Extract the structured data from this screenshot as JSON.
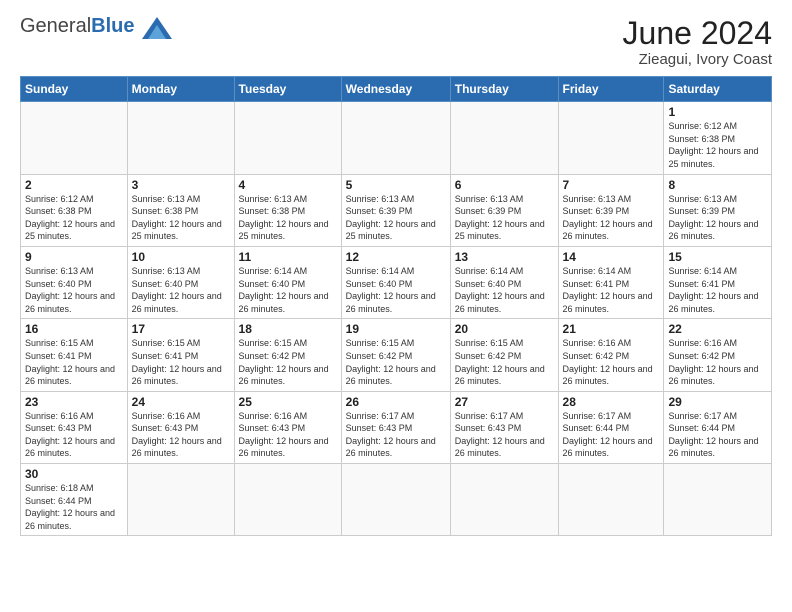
{
  "logo": {
    "text_general": "General",
    "text_blue": "Blue"
  },
  "header": {
    "title": "June 2024",
    "subtitle": "Zieagui, Ivory Coast"
  },
  "weekdays": [
    "Sunday",
    "Monday",
    "Tuesday",
    "Wednesday",
    "Thursday",
    "Friday",
    "Saturday"
  ],
  "weeks": [
    [
      {
        "day": "",
        "info": ""
      },
      {
        "day": "",
        "info": ""
      },
      {
        "day": "",
        "info": ""
      },
      {
        "day": "",
        "info": ""
      },
      {
        "day": "",
        "info": ""
      },
      {
        "day": "",
        "info": ""
      },
      {
        "day": "1",
        "info": "Sunrise: 6:12 AM\nSunset: 6:38 PM\nDaylight: 12 hours and 25 minutes."
      }
    ],
    [
      {
        "day": "2",
        "info": "Sunrise: 6:12 AM\nSunset: 6:38 PM\nDaylight: 12 hours and 25 minutes."
      },
      {
        "day": "3",
        "info": "Sunrise: 6:13 AM\nSunset: 6:38 PM\nDaylight: 12 hours and 25 minutes."
      },
      {
        "day": "4",
        "info": "Sunrise: 6:13 AM\nSunset: 6:38 PM\nDaylight: 12 hours and 25 minutes."
      },
      {
        "day": "5",
        "info": "Sunrise: 6:13 AM\nSunset: 6:39 PM\nDaylight: 12 hours and 25 minutes."
      },
      {
        "day": "6",
        "info": "Sunrise: 6:13 AM\nSunset: 6:39 PM\nDaylight: 12 hours and 25 minutes."
      },
      {
        "day": "7",
        "info": "Sunrise: 6:13 AM\nSunset: 6:39 PM\nDaylight: 12 hours and 26 minutes."
      },
      {
        "day": "8",
        "info": "Sunrise: 6:13 AM\nSunset: 6:39 PM\nDaylight: 12 hours and 26 minutes."
      }
    ],
    [
      {
        "day": "9",
        "info": "Sunrise: 6:13 AM\nSunset: 6:40 PM\nDaylight: 12 hours and 26 minutes."
      },
      {
        "day": "10",
        "info": "Sunrise: 6:13 AM\nSunset: 6:40 PM\nDaylight: 12 hours and 26 minutes."
      },
      {
        "day": "11",
        "info": "Sunrise: 6:14 AM\nSunset: 6:40 PM\nDaylight: 12 hours and 26 minutes."
      },
      {
        "day": "12",
        "info": "Sunrise: 6:14 AM\nSunset: 6:40 PM\nDaylight: 12 hours and 26 minutes."
      },
      {
        "day": "13",
        "info": "Sunrise: 6:14 AM\nSunset: 6:40 PM\nDaylight: 12 hours and 26 minutes."
      },
      {
        "day": "14",
        "info": "Sunrise: 6:14 AM\nSunset: 6:41 PM\nDaylight: 12 hours and 26 minutes."
      },
      {
        "day": "15",
        "info": "Sunrise: 6:14 AM\nSunset: 6:41 PM\nDaylight: 12 hours and 26 minutes."
      }
    ],
    [
      {
        "day": "16",
        "info": "Sunrise: 6:15 AM\nSunset: 6:41 PM\nDaylight: 12 hours and 26 minutes."
      },
      {
        "day": "17",
        "info": "Sunrise: 6:15 AM\nSunset: 6:41 PM\nDaylight: 12 hours and 26 minutes."
      },
      {
        "day": "18",
        "info": "Sunrise: 6:15 AM\nSunset: 6:42 PM\nDaylight: 12 hours and 26 minutes."
      },
      {
        "day": "19",
        "info": "Sunrise: 6:15 AM\nSunset: 6:42 PM\nDaylight: 12 hours and 26 minutes."
      },
      {
        "day": "20",
        "info": "Sunrise: 6:15 AM\nSunset: 6:42 PM\nDaylight: 12 hours and 26 minutes."
      },
      {
        "day": "21",
        "info": "Sunrise: 6:16 AM\nSunset: 6:42 PM\nDaylight: 12 hours and 26 minutes."
      },
      {
        "day": "22",
        "info": "Sunrise: 6:16 AM\nSunset: 6:42 PM\nDaylight: 12 hours and 26 minutes."
      }
    ],
    [
      {
        "day": "23",
        "info": "Sunrise: 6:16 AM\nSunset: 6:43 PM\nDaylight: 12 hours and 26 minutes."
      },
      {
        "day": "24",
        "info": "Sunrise: 6:16 AM\nSunset: 6:43 PM\nDaylight: 12 hours and 26 minutes."
      },
      {
        "day": "25",
        "info": "Sunrise: 6:16 AM\nSunset: 6:43 PM\nDaylight: 12 hours and 26 minutes."
      },
      {
        "day": "26",
        "info": "Sunrise: 6:17 AM\nSunset: 6:43 PM\nDaylight: 12 hours and 26 minutes."
      },
      {
        "day": "27",
        "info": "Sunrise: 6:17 AM\nSunset: 6:43 PM\nDaylight: 12 hours and 26 minutes."
      },
      {
        "day": "28",
        "info": "Sunrise: 6:17 AM\nSunset: 6:44 PM\nDaylight: 12 hours and 26 minutes."
      },
      {
        "day": "29",
        "info": "Sunrise: 6:17 AM\nSunset: 6:44 PM\nDaylight: 12 hours and 26 minutes."
      }
    ],
    [
      {
        "day": "30",
        "info": "Sunrise: 6:18 AM\nSunset: 6:44 PM\nDaylight: 12 hours and 26 minutes."
      },
      {
        "day": "",
        "info": ""
      },
      {
        "day": "",
        "info": ""
      },
      {
        "day": "",
        "info": ""
      },
      {
        "day": "",
        "info": ""
      },
      {
        "day": "",
        "info": ""
      },
      {
        "day": "",
        "info": ""
      }
    ]
  ]
}
